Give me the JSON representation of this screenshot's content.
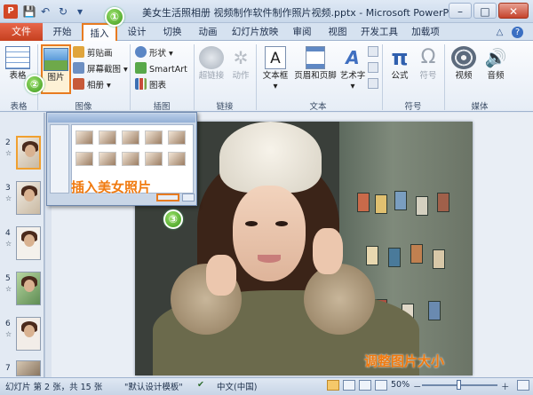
{
  "window": {
    "app_icon": "P",
    "title": "美女生活照相册 视频制作软件制作照片视频.pptx - Microsoft PowerPoint",
    "controls": {
      "minimize": "–",
      "maximize": "□",
      "close": "✕"
    }
  },
  "quick_access": {
    "save_icon": "💾",
    "undo_icon": "↶",
    "redo_icon": "↻",
    "customize_icon": "▾"
  },
  "tabs": {
    "file": "文件",
    "items": [
      "开始",
      "插入",
      "设计",
      "切换",
      "动画",
      "幻灯片放映",
      "审阅",
      "视图",
      "开发工具",
      "加载项"
    ],
    "active": "插入",
    "right_icons": [
      "△",
      "?"
    ]
  },
  "ribbon": {
    "groups": {
      "tables": "表格",
      "images": "图像",
      "illustrations": "插图",
      "links": "链接",
      "text": "文本",
      "symbols": "符号",
      "media": "媒体"
    },
    "table": "表格",
    "picture": "图片",
    "clip_art": "剪贴画",
    "screenshot": "屏幕截图",
    "album": "相册",
    "shapes": "形状",
    "smartart": "SmartArt",
    "chart": "图表",
    "hyperlink": "超链接",
    "action": "动作",
    "textbox": "文本框",
    "header_footer": "页眉和页脚",
    "wordart": "艺术字",
    "formula": "公式",
    "symbol": "符号",
    "video": "视频",
    "audio": "音频",
    "pi_glyph": "π",
    "omega_glyph": "Ω"
  },
  "thumbnails": {
    "numbers": [
      "2",
      "3",
      "4",
      "5",
      "6",
      "7"
    ],
    "star": "☆"
  },
  "annotations": {
    "step1": "①",
    "step2": "②",
    "step3": "③",
    "insert_caption": "插入美女照片",
    "resize_caption": "调整图片大小"
  },
  "status": {
    "slide_info": "幻灯片 第 2 张，共 15 张",
    "theme": "\"默认设计模板\"",
    "language": "中文(中国)",
    "zoom": "50%",
    "zoom_minus": "－",
    "zoom_plus": "＋"
  },
  "colors": {
    "accent_orange": "#e87b20",
    "file_tab": "#c5401f",
    "step_green": "#3c9a1c"
  }
}
